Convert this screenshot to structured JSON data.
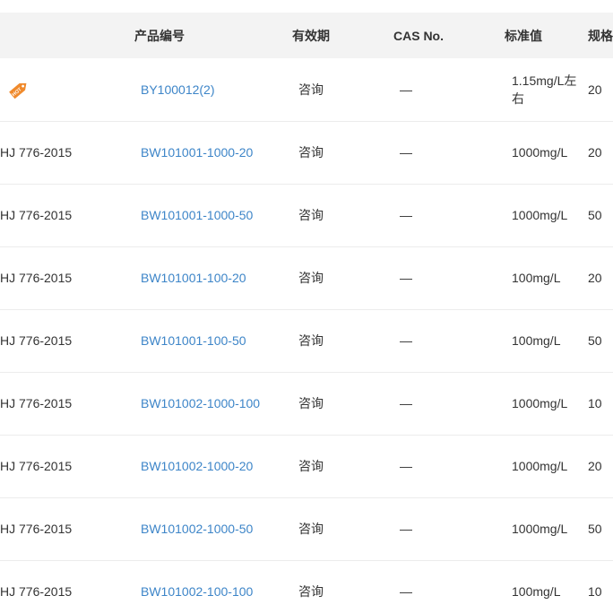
{
  "table": {
    "headers": {
      "standard": "",
      "product_no": "产品编号",
      "validity": "有效期",
      "cas": "CAS No.",
      "std_value": "标准值",
      "spec": "规格"
    },
    "rows": [
      {
        "standard": "",
        "hot": true,
        "product_no": "BY100012(2)",
        "validity": "咨询",
        "cas": "—",
        "std_value": "1.15mg/L左右",
        "spec": "20"
      },
      {
        "standard": "HJ 776-2015",
        "hot": false,
        "product_no": "BW101001-1000-20",
        "validity": "咨询",
        "cas": "—",
        "std_value": "1000mg/L",
        "spec": "20"
      },
      {
        "standard": "HJ 776-2015",
        "hot": false,
        "product_no": "BW101001-1000-50",
        "validity": "咨询",
        "cas": "—",
        "std_value": "1000mg/L",
        "spec": "50"
      },
      {
        "standard": "HJ 776-2015",
        "hot": false,
        "product_no": "BW101001-100-20",
        "validity": "咨询",
        "cas": "—",
        "std_value": "100mg/L",
        "spec": "20"
      },
      {
        "standard": "HJ 776-2015",
        "hot": false,
        "product_no": "BW101001-100-50",
        "validity": "咨询",
        "cas": "—",
        "std_value": "100mg/L",
        "spec": "50"
      },
      {
        "standard": "HJ 776-2015",
        "hot": false,
        "product_no": "BW101002-1000-100",
        "validity": "咨询",
        "cas": "—",
        "std_value": "1000mg/L",
        "spec": "10"
      },
      {
        "standard": "HJ 776-2015",
        "hot": false,
        "product_no": "BW101002-1000-20",
        "validity": "咨询",
        "cas": "—",
        "std_value": "1000mg/L",
        "spec": "20"
      },
      {
        "standard": "HJ 776-2015",
        "hot": false,
        "product_no": "BW101002-1000-50",
        "validity": "咨询",
        "cas": "—",
        "std_value": "1000mg/L",
        "spec": "50"
      },
      {
        "standard": "HJ 776-2015",
        "hot": false,
        "product_no": "BW101002-100-100",
        "validity": "咨询",
        "cas": "—",
        "std_value": "100mg/L",
        "spec": "10"
      }
    ],
    "hot_badge": {
      "icon": "hot-tag-icon",
      "color": "#f08a2c",
      "text": "HOT"
    },
    "link_color": "#3d85c8",
    "header_bg": "#f3f3f3"
  }
}
